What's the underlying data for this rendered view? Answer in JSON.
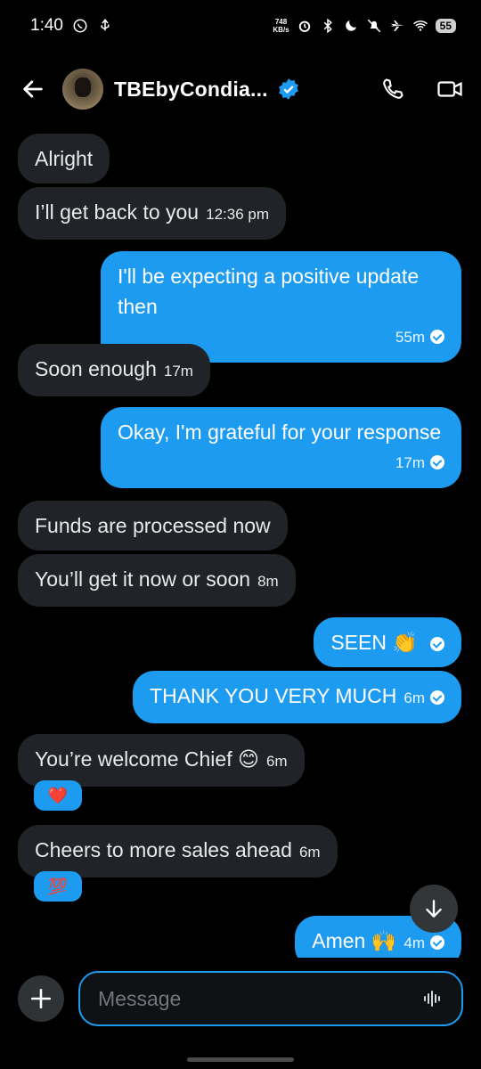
{
  "status": {
    "time": "1:40",
    "netspeed_value": "748",
    "netspeed_unit": "KB/s",
    "battery": "55"
  },
  "header": {
    "contact_name": "TBEbyCondia..."
  },
  "messages": [
    {
      "text": "Alright",
      "time": ""
    },
    {
      "text": "I’ll get back to you",
      "time": "12:36 pm"
    },
    {
      "text": "I'll be expecting a positive update then",
      "time": "55m"
    },
    {
      "text": "Soon enough",
      "time": "17m"
    },
    {
      "text": "Okay, I'm grateful for your response",
      "time": "17m"
    },
    {
      "text": "Funds are processed now",
      "time": ""
    },
    {
      "text": "You’ll get it now or soon",
      "time": "8m"
    },
    {
      "text": "SEEN 👏",
      "time": ""
    },
    {
      "text": "THANK YOU VERY MUCH",
      "time": "6m"
    },
    {
      "text": "You’re welcome Chief 😊",
      "time": "6m"
    },
    {
      "text": "Cheers to more sales ahead",
      "time": "6m"
    },
    {
      "text": "Amen 🙌",
      "time": "4m"
    }
  ],
  "reactions": [
    "❤️",
    "💯"
  ],
  "composer": {
    "placeholder": "Message"
  },
  "colors": {
    "accent": "#1d9bf0",
    "incoming_bubble": "#202327",
    "background": "#000000"
  }
}
